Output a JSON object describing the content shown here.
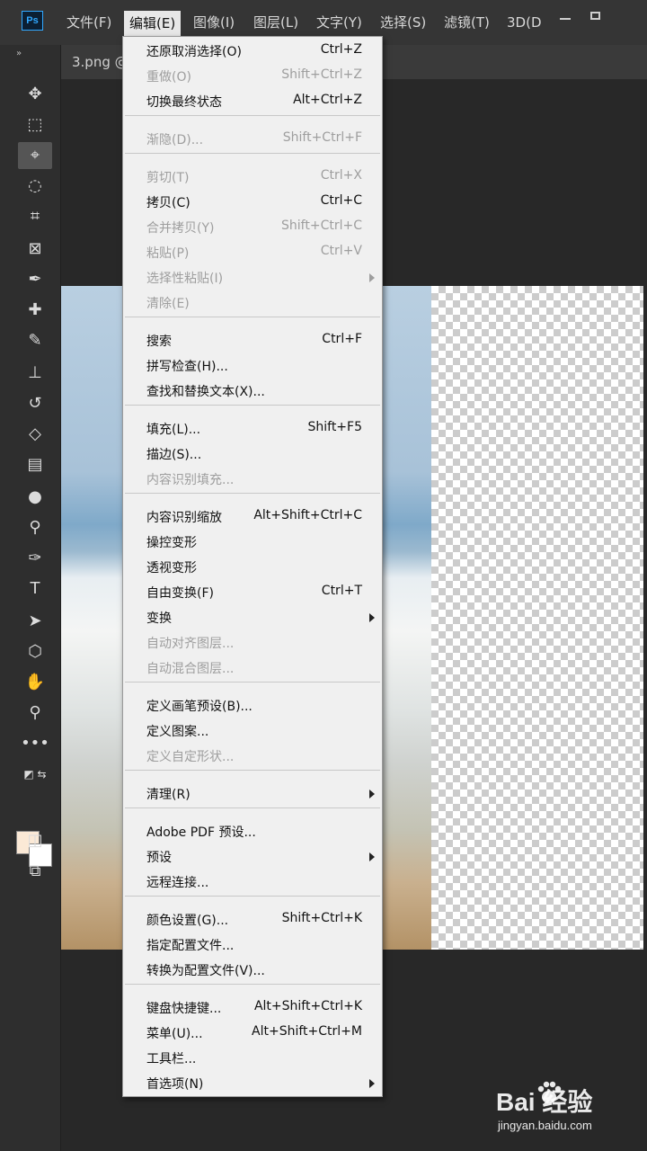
{
  "app": {
    "logo_text": "Ps",
    "menus": [
      "文件(F)",
      "编辑(E)",
      "图像(I)",
      "图层(L)",
      "文字(Y)",
      "选择(S)",
      "滤镜(T)",
      "3D(D"
    ],
    "active_menu": "编辑(E)",
    "window_controls": [
      "minimize-icon",
      "restore-icon"
    ]
  },
  "document": {
    "tab_label": "3.png @"
  },
  "toolbar": {
    "tools": [
      "move-icon",
      "marquee-icon",
      "lasso-icon",
      "quick-select-icon",
      "crop-icon",
      "frame-icon",
      "eyedropper-icon",
      "healing-icon",
      "brush-icon",
      "stamp-icon",
      "history-brush-icon",
      "eraser-icon",
      "gradient-icon",
      "blur-icon",
      "dodge-icon",
      "pen-icon",
      "type-icon",
      "path-select-icon",
      "shape-icon",
      "hand-icon",
      "zoom-icon",
      "more-icon",
      "quick-mask-icon",
      "screen-mode-icon"
    ],
    "foreground_color": "#fbe9d6",
    "background_color": "#ffffff"
  },
  "edit_menu": {
    "items": [
      {
        "label": "还原取消选择(O)",
        "shortcut": "Ctrl+Z",
        "enabled": true
      },
      {
        "label": "重做(O)",
        "shortcut": "Shift+Ctrl+Z",
        "enabled": false
      },
      {
        "label": "切换最终状态",
        "shortcut": "Alt+Ctrl+Z",
        "enabled": true
      },
      {
        "label": "渐隐(D)...",
        "shortcut": "Shift+Ctrl+F",
        "enabled": false
      },
      {
        "label": "剪切(T)",
        "shortcut": "Ctrl+X",
        "enabled": false
      },
      {
        "label": "拷贝(C)",
        "shortcut": "Ctrl+C",
        "enabled": true
      },
      {
        "label": "合并拷贝(Y)",
        "shortcut": "Shift+Ctrl+C",
        "enabled": false
      },
      {
        "label": "粘贴(P)",
        "shortcut": "Ctrl+V",
        "enabled": false
      },
      {
        "label": "选择性粘贴(I)",
        "shortcut": "",
        "enabled": false,
        "submenu": true
      },
      {
        "label": "清除(E)",
        "shortcut": "",
        "enabled": false
      },
      {
        "label": "搜索",
        "shortcut": "Ctrl+F",
        "enabled": true
      },
      {
        "label": "拼写检查(H)...",
        "shortcut": "",
        "enabled": true
      },
      {
        "label": "查找和替换文本(X)...",
        "shortcut": "",
        "enabled": true
      },
      {
        "label": "填充(L)...",
        "shortcut": "Shift+F5",
        "enabled": true
      },
      {
        "label": "描边(S)...",
        "shortcut": "",
        "enabled": true
      },
      {
        "label": "内容识别填充...",
        "shortcut": "",
        "enabled": false
      },
      {
        "label": "内容识别缩放",
        "shortcut": "Alt+Shift+Ctrl+C",
        "enabled": true
      },
      {
        "label": "操控变形",
        "shortcut": "",
        "enabled": true
      },
      {
        "label": "透视变形",
        "shortcut": "",
        "enabled": true
      },
      {
        "label": "自由变换(F)",
        "shortcut": "Ctrl+T",
        "enabled": true
      },
      {
        "label": "变换",
        "shortcut": "",
        "enabled": true,
        "submenu": true
      },
      {
        "label": "自动对齐图层...",
        "shortcut": "",
        "enabled": false
      },
      {
        "label": "自动混合图层...",
        "shortcut": "",
        "enabled": false
      },
      {
        "label": "定义画笔预设(B)...",
        "shortcut": "",
        "enabled": true
      },
      {
        "label": "定义图案...",
        "shortcut": "",
        "enabled": true
      },
      {
        "label": "定义自定形状...",
        "shortcut": "",
        "enabled": false
      },
      {
        "label": "清理(R)",
        "shortcut": "",
        "enabled": true,
        "submenu": true
      },
      {
        "label": "Adobe PDF 预设...",
        "shortcut": "",
        "enabled": true
      },
      {
        "label": "预设",
        "shortcut": "",
        "enabled": true,
        "submenu": true
      },
      {
        "label": "远程连接...",
        "shortcut": "",
        "enabled": true
      },
      {
        "label": "颜色设置(G)...",
        "shortcut": "Shift+Ctrl+K",
        "enabled": true
      },
      {
        "label": "指定配置文件...",
        "shortcut": "",
        "enabled": true
      },
      {
        "label": "转换为配置文件(V)...",
        "shortcut": "",
        "enabled": true
      },
      {
        "label": "键盘快捷键...",
        "shortcut": "Alt+Shift+Ctrl+K",
        "enabled": true
      },
      {
        "label": "菜单(U)...",
        "shortcut": "Alt+Shift+Ctrl+M",
        "enabled": true
      },
      {
        "label": "工具栏...",
        "shortcut": "",
        "enabled": true
      },
      {
        "label": "首选项(N)",
        "shortcut": "",
        "enabled": true,
        "submenu": true
      }
    ]
  },
  "watermark": {
    "title": "Bai  经验",
    "url": "jingyan.baidu.com"
  }
}
